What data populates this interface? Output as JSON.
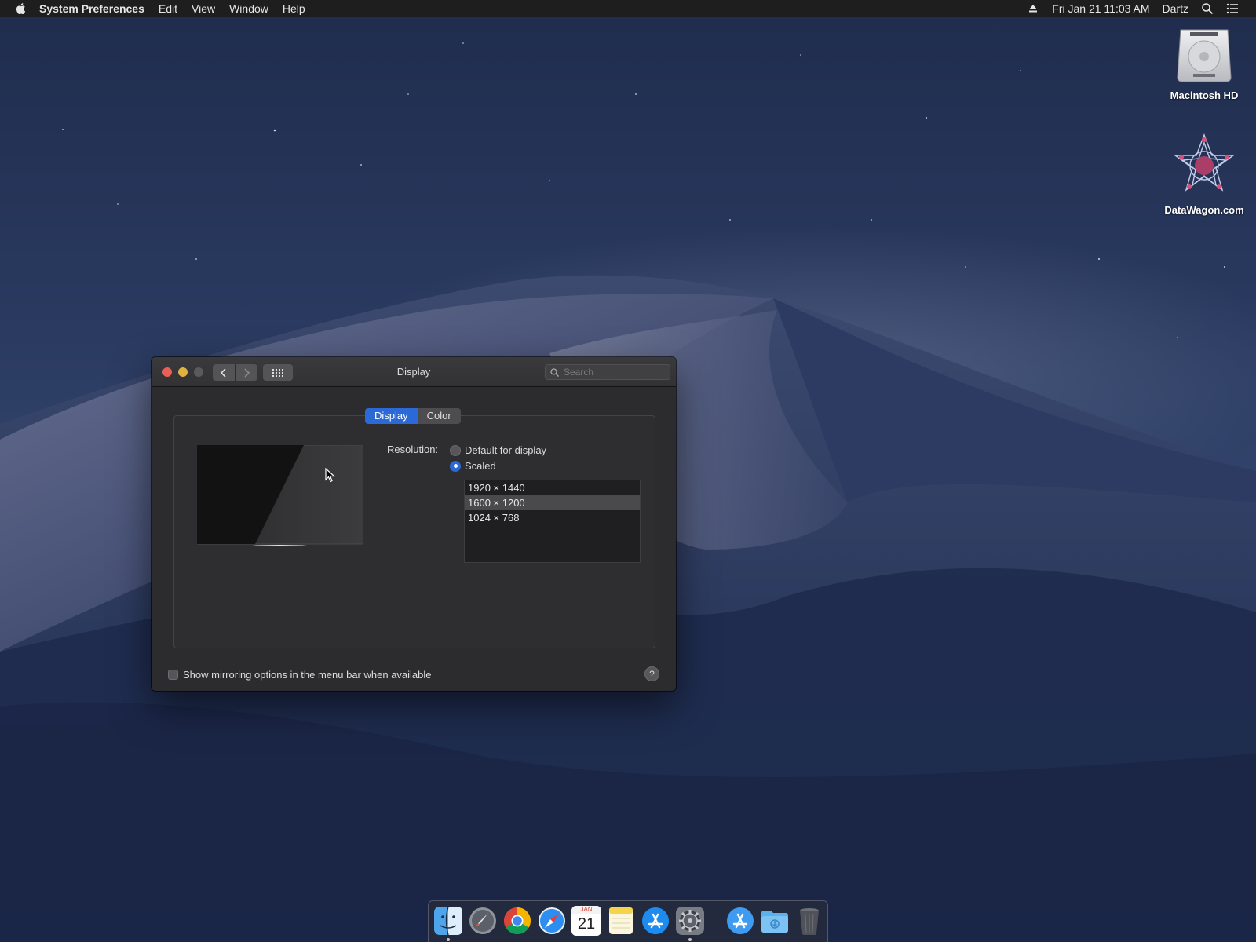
{
  "menubar": {
    "app_name": "System Preferences",
    "menus": [
      "Edit",
      "View",
      "Window",
      "Help"
    ],
    "datetime": "Fri Jan 21  11:03 AM",
    "user": "Dartz"
  },
  "desktop": {
    "icons": [
      {
        "label": "Macintosh HD",
        "icon": "hard-drive-icon"
      },
      {
        "label": "DataWagon.com",
        "icon": "datawagon-logo-icon"
      }
    ]
  },
  "window": {
    "title": "Display",
    "search_placeholder": "Search",
    "tabs": {
      "active": "Display",
      "other": "Color"
    },
    "resolution": {
      "label": "Resolution:",
      "options": [
        "Default for display",
        "Scaled"
      ],
      "selected_option": "Scaled",
      "list": [
        "1920 × 1440",
        "1600 × 1200",
        "1024 × 768"
      ],
      "selected_resolution": "1600 × 1200"
    },
    "mirroring_checkbox_label": "Show mirroring options in the menu bar when available",
    "mirroring_checked": false,
    "help_label": "?"
  },
  "dock": {
    "apps": [
      "Finder",
      "Launchpad",
      "Google Chrome",
      "Safari",
      "Calendar",
      "Notes",
      "App Store",
      "System Preferences",
      "Applications",
      "Downloads",
      "Trash"
    ],
    "calendar_month": "JAN",
    "calendar_day": "21"
  },
  "colors": {
    "accent": "#2a69d6",
    "close": "#ec5f57",
    "minimize": "#e0b23e"
  }
}
